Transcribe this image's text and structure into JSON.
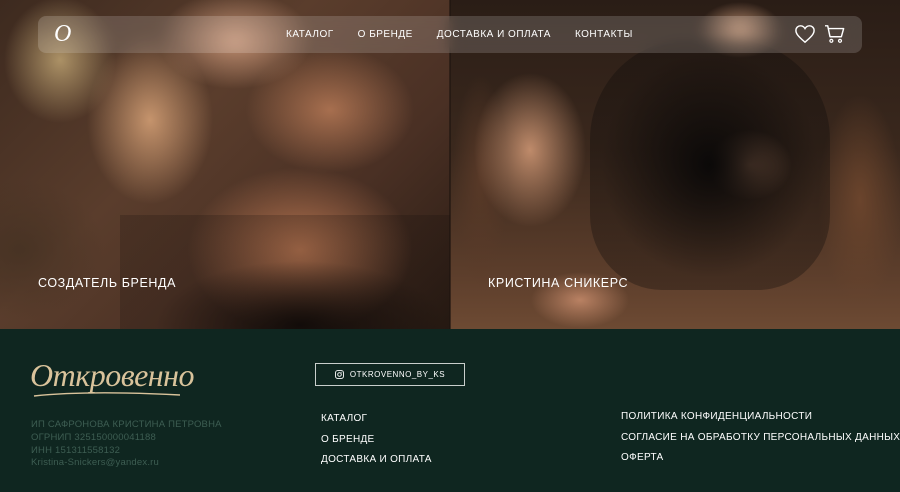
{
  "nav": {
    "logo_letter": "O",
    "links": [
      "КАТАЛОГ",
      "О БРЕНДЕ",
      "ДОСТАВКА И ОПЛАТА",
      "КОНТАКТЫ"
    ],
    "icons": [
      "heart-icon",
      "cart-icon"
    ]
  },
  "hero": {
    "left_caption": "СОЗДАТЕЛЬ БРЕНДА",
    "right_caption": "КРИСТИНА СНИКЕРС"
  },
  "footer": {
    "logo_text": "Откровенно",
    "instagram_label": "OTKROVENNO_BY_KS",
    "legal": [
      "ИП САФРОНОВА КРИСТИНА ПЕТРОВНА",
      "ОГРНИП 325150000041188",
      "ИНН 151311558132",
      "Kristina-Snickers@yandex.ru"
    ],
    "menu_links": [
      "КАТАЛОГ",
      "О БРЕНДЕ",
      "ДОСТАВКА И ОПЛАТА"
    ],
    "policy_links": [
      "ПОЛИТИКА КОНФИДЕНЦИАЛЬНОСТИ",
      "СОГЛАСИЕ НА ОБРАБОТКУ ПЕРСОНАЛЬНЫХ ДАННЫХ",
      "ОФЕРТА"
    ]
  },
  "colors": {
    "footer_bg": "#0f2620",
    "logo_gold": "#d9c39b",
    "legal_text": "#3d5d52"
  }
}
